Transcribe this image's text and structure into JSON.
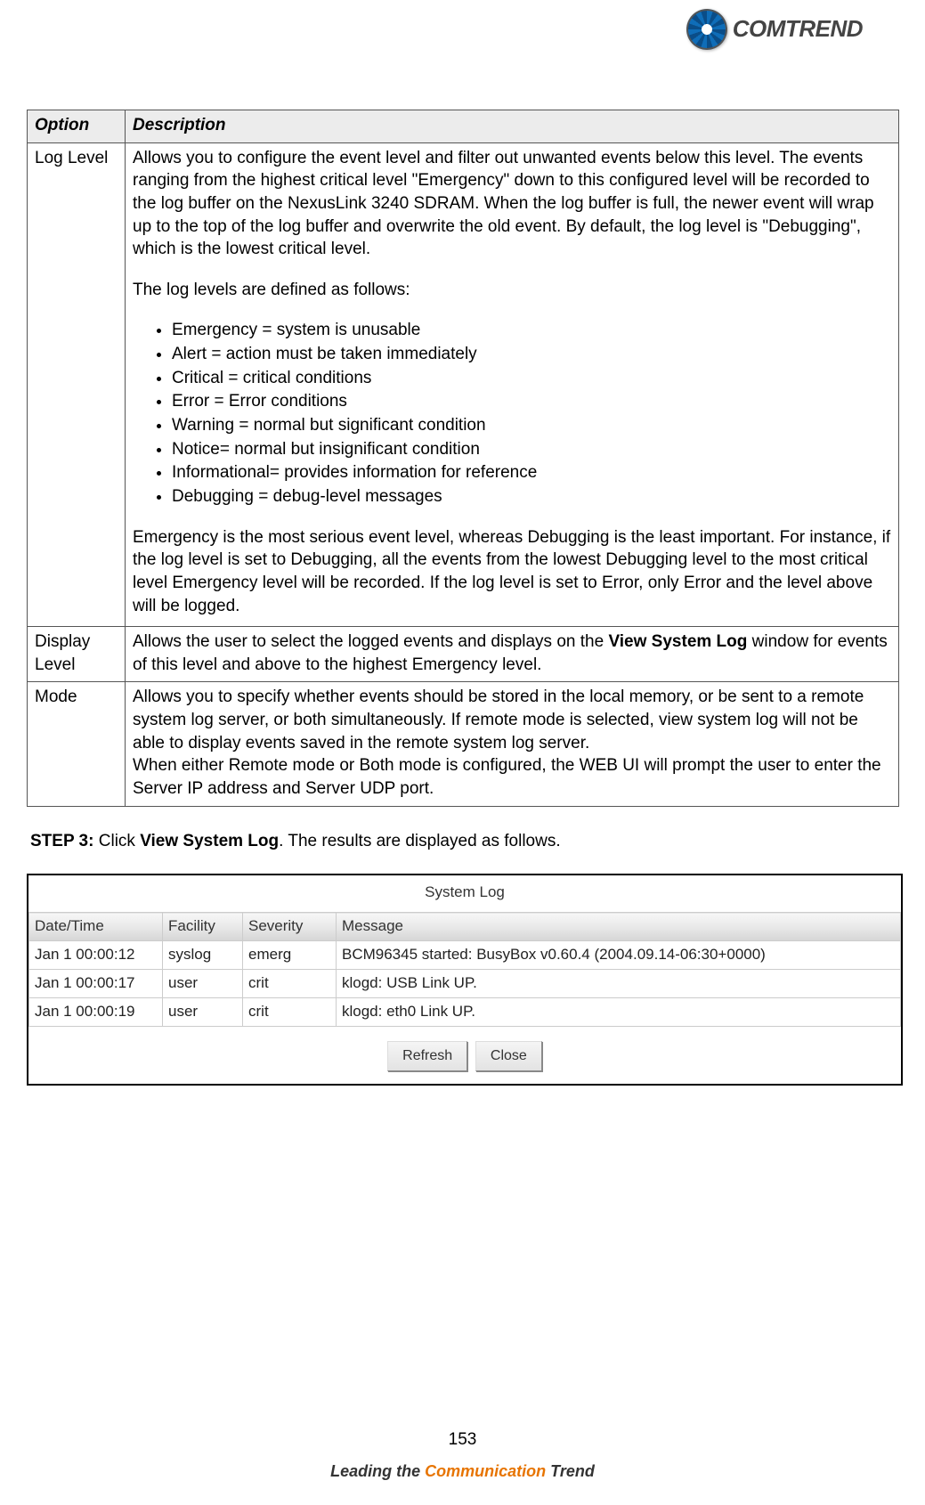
{
  "brand": {
    "name": "COMTREND"
  },
  "table": {
    "headers": [
      "Option",
      "Description"
    ],
    "rows": {
      "logLevel": {
        "option": "Log Level",
        "p1": "Allows you to configure the event level and filter out unwanted events below this level.   The events ranging from the highest critical level \"Emergency\" down to this configured level will be recorded to the log buffer on the NexusLink 3240 SDRAM.   When the log buffer is full, the newer event will wrap up to the top of the log buffer and overwrite the old event. By default, the log level is \"Debugging\", which is the lowest critical level.",
        "p2": "The log levels are defined as follows:",
        "levels": [
          "Emergency = system is unusable",
          "Alert = action must be taken immediately",
          "Critical = critical conditions",
          "Error = Error conditions",
          "Warning = normal but significant condition",
          "Notice= normal but insignificant condition",
          "Informational= provides information for reference",
          "Debugging = debug-level messages"
        ],
        "p3": "Emergency is the most serious event level, whereas Debugging is the least important.   For instance, if the log level is set to Debugging, all the events from the lowest Debugging level to the most critical level Emergency level will be recorded.   If the log level is set to Error, only Error and the level above will be logged."
      },
      "displayLevel": {
        "option": "Display Level",
        "text_pre": "Allows the user to select the logged events and displays on the ",
        "bold": "View System Log",
        "text_post": " window for events of this level and above to the highest Emergency level."
      },
      "mode": {
        "option": "Mode",
        "p1": "Allows you to specify whether events should be stored in the local memory, or be sent to a remote system log server, or both simultaneously.   If remote mode is selected, view system log will not be able to display events saved in the remote system log server.",
        "p2": "When either Remote mode or Both mode is configured, the WEB UI will prompt the user to enter the Server IP address and Server UDP port."
      }
    }
  },
  "step3": {
    "label": "STEP 3:",
    "pre": "  Click ",
    "bold": "View System Log",
    "post": ".   The results are displayed as follows."
  },
  "syslog": {
    "title": "System Log",
    "headers": [
      "Date/Time",
      "Facility",
      "Severity",
      "Message"
    ],
    "rows": [
      {
        "dt": "Jan 1 00:00:12",
        "fac": "syslog",
        "sev": "emerg",
        "msg": "BCM96345 started: BusyBox v0.60.4 (2004.09.14-06:30+0000)"
      },
      {
        "dt": "Jan 1 00:00:17",
        "fac": "user",
        "sev": "crit",
        "msg": "klogd: USB Link UP."
      },
      {
        "dt": "Jan 1 00:00:19",
        "fac": "user",
        "sev": "crit",
        "msg": "klogd: eth0 Link UP."
      }
    ],
    "buttons": {
      "refresh": "Refresh",
      "close": "Close"
    }
  },
  "footer": {
    "page": "153",
    "tagline_pre": "Leading the ",
    "tagline_hi": "Communication",
    "tagline_post": " Trend"
  }
}
